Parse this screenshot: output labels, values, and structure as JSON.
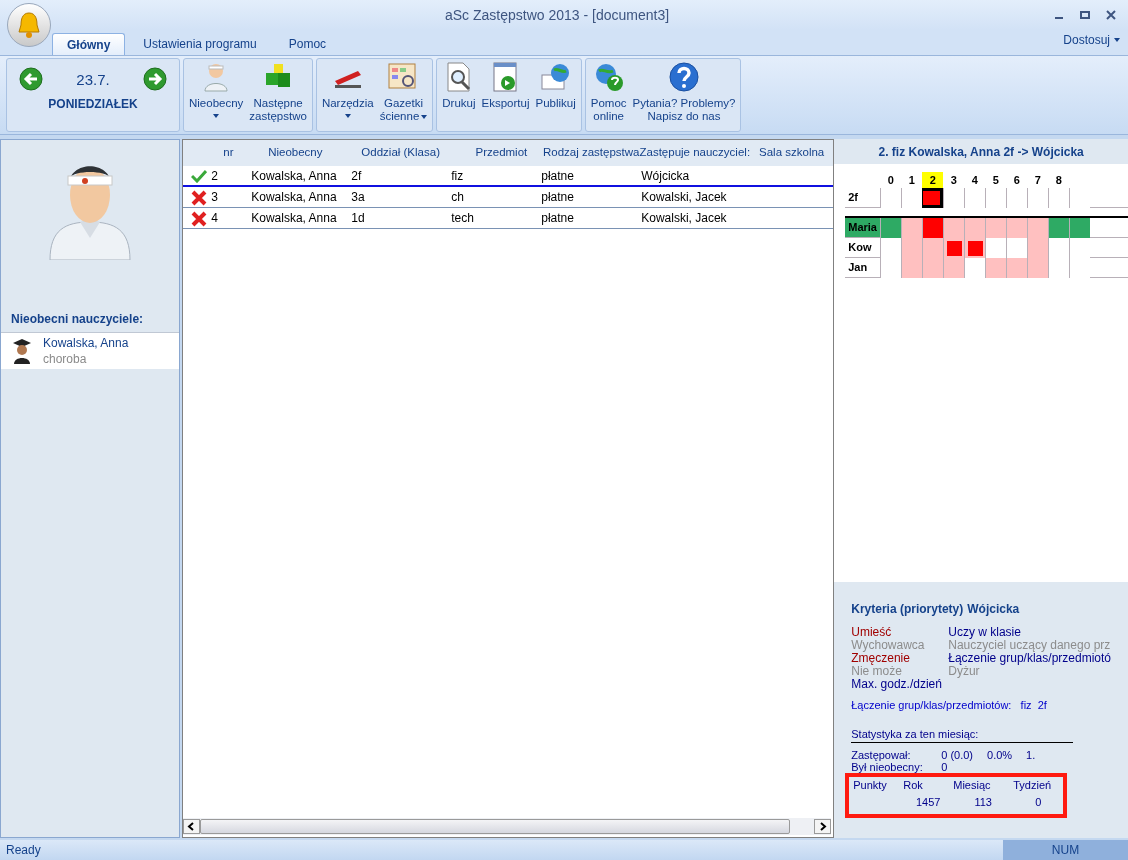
{
  "window": {
    "title": "aSc Zastępstwo 2013  - [document3]",
    "customize": "Dostosuj"
  },
  "tabs": [
    {
      "label": "Główny",
      "selected": true
    },
    {
      "label": "Ustawienia programu",
      "selected": false
    },
    {
      "label": "Pomoc",
      "selected": false
    }
  ],
  "date": {
    "day": "23.7.",
    "weekday": "PONIEDZIAŁEK"
  },
  "ribbon_groups": [
    {
      "buttons": [
        {
          "lines": [
            "Nieobecny"
          ],
          "dropdown": true
        },
        {
          "lines": [
            "Następne",
            "zastępstwo"
          ],
          "dropdown": false
        }
      ]
    },
    {
      "buttons": [
        {
          "lines": [
            "Narzędzia"
          ],
          "dropdown": true
        },
        {
          "lines": [
            "Gazetki",
            "ścienne"
          ],
          "dropdown": true
        }
      ]
    },
    {
      "buttons": [
        {
          "lines": [
            "Drukuj"
          ],
          "dropdown": false
        },
        {
          "lines": [
            "Eksportuj"
          ],
          "dropdown": false
        },
        {
          "lines": [
            "Publikuj"
          ],
          "dropdown": false
        }
      ]
    },
    {
      "buttons": [
        {
          "lines": [
            "Pomoc",
            "online"
          ],
          "dropdown": false
        },
        {
          "lines": [
            "Pytania? Problemy?",
            "Napisz do nas"
          ],
          "dropdown": false
        }
      ]
    }
  ],
  "sidebar": {
    "heading": "Nieobecni nauczyciele:",
    "items": [
      {
        "name": "Kowalska, Anna",
        "reason": "choroba",
        "selected": true
      }
    ]
  },
  "table": {
    "columns": [
      "nr",
      "Nieobecny",
      "Oddział (Klasa)",
      "Przedmiot",
      "Rodzaj zastępstwa",
      "Zastępuje nauczyciel:",
      "Sala szkolna"
    ],
    "rows": [
      {
        "kind": "ok",
        "selected": true,
        "cells": [
          "2",
          "Kowalska, Anna",
          "2f",
          "fiz",
          "płatne",
          "Wójcicka"
        ]
      },
      {
        "kind": "failed",
        "selected": false,
        "cells": [
          "3",
          "Kowalska, Anna",
          "3a",
          "ch",
          "płatne",
          "Kowalski, Jacek"
        ]
      },
      {
        "kind": "failed",
        "selected": false,
        "cells": [
          "4",
          "Kowalska, Anna",
          "1d",
          "tech",
          "płatne",
          "Kowalski, Jacek"
        ]
      }
    ]
  },
  "detail": {
    "title": "2. fiz Kowalska, Anna 2f -> Wójcicka",
    "periods": [
      {
        "label": "0",
        "selected": false
      },
      {
        "label": "1",
        "selected": false
      },
      {
        "label": "2",
        "selected": true
      },
      {
        "label": "3",
        "selected": false
      },
      {
        "label": "4",
        "selected": false
      },
      {
        "label": "5",
        "selected": false
      },
      {
        "label": "6",
        "selected": false
      },
      {
        "label": "7",
        "selected": false
      },
      {
        "label": "8",
        "selected": false
      }
    ],
    "class_row": {
      "label": "2f",
      "cells": [
        {
          "kind": "free"
        },
        {
          "kind": "free"
        },
        {
          "kind": "target"
        },
        {
          "kind": "free"
        },
        {
          "kind": "free"
        },
        {
          "kind": "free"
        },
        {
          "kind": "free"
        },
        {
          "kind": "free"
        },
        {
          "kind": "free"
        },
        {
          "kind": "free"
        }
      ]
    },
    "teacher_rows": [
      {
        "label": "Maria",
        "selected": true,
        "cells": [
          {
            "kind": "green"
          },
          {
            "kind": "pink"
          },
          {
            "kind": "red"
          },
          {
            "kind": "pink"
          },
          {
            "kind": "pink"
          },
          {
            "kind": "pink"
          },
          {
            "kind": "pink"
          },
          {
            "kind": "pink"
          },
          {
            "kind": "green"
          },
          {
            "kind": "green"
          }
        ]
      },
      {
        "label": "Kow",
        "selected": false,
        "cells": [
          {
            "kind": "free"
          },
          {
            "kind": "pink"
          },
          {
            "kind": "pink"
          },
          {
            "kind": "mark"
          },
          {
            "kind": "mark"
          },
          {
            "kind": "free"
          },
          {
            "kind": "free"
          },
          {
            "kind": "pink"
          },
          {
            "kind": "free"
          },
          {
            "kind": "free"
          }
        ]
      },
      {
        "label": "Jan",
        "selected": false,
        "cells": [
          {
            "kind": "free"
          },
          {
            "kind": "pink"
          },
          {
            "kind": "pink"
          },
          {
            "kind": "pink"
          },
          {
            "kind": "free"
          },
          {
            "kind": "pink"
          },
          {
            "kind": "pink"
          },
          {
            "kind": "pink"
          },
          {
            "kind": "free"
          },
          {
            "kind": "free"
          }
        ]
      }
    ],
    "criteria_heading": "Kryteria (priorytety)",
    "criteria_teacher": "Wójcicka",
    "criteria_left": [
      {
        "text": "Umieść",
        "color": "#a00000"
      },
      {
        "text": "Wychowawca",
        "color": "#8c8c8c"
      },
      {
        "text": "Zmęczenie",
        "color": "#a00000"
      },
      {
        "text": "Nie może",
        "color": "#8c8c8c"
      },
      {
        "text": "Max. godz./dzień",
        "color": "#00008b"
      }
    ],
    "criteria_right": [
      {
        "text": "Uczy w klasie",
        "color": "#00008b"
      },
      {
        "text": "Nauczyciel uczący danego prz",
        "color": "#8c8c8c"
      },
      {
        "text": "Łączenie grup/klas/przedmiotó",
        "color": "#00008b"
      },
      {
        "text": "Dyżur",
        "color": "#8c8c8c"
      }
    ],
    "joining": "Łączenie grup/klas/przedmiotów:   fiz  2f",
    "stats_heading": "Statystyka za ten miesiąc:",
    "stats": [
      {
        "label": "Zastępował:",
        "values": [
          "0 (0.0)",
          "0.0%",
          "1."
        ]
      },
      {
        "label": "Był nieobecny:",
        "values": [
          "0"
        ]
      }
    ],
    "points": {
      "columns": [
        "Punkty",
        "Rok",
        "Miesiąc",
        "Tydzień"
      ],
      "values": [
        "1457",
        "113",
        "0"
      ]
    }
  },
  "status_bar": {
    "text": "Ready",
    "num": "NUM"
  }
}
